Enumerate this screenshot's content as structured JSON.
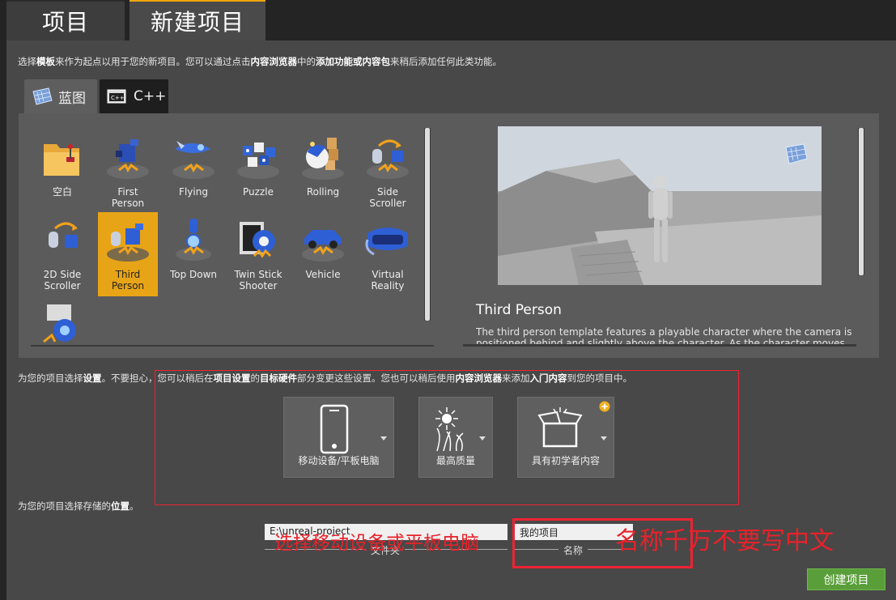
{
  "tabs": {
    "projects": "项目",
    "new_project": "新建项目"
  },
  "template_hint": {
    "p1": "选择",
    "b1": "模板",
    "p2": "来作为起点以用于您的新项目。您可以通过点击",
    "b2": "内容浏览器",
    "p3": "中的",
    "b3": "添加功能或内容包",
    "p4": "来稍后添加任何此类功能。"
  },
  "lang_tabs": {
    "blueprint": "蓝图",
    "cpp": "C++"
  },
  "templates": [
    {
      "label": "空白",
      "icon": "folder-joystick-icon"
    },
    {
      "label": "First\nPerson",
      "icon": "first-person-icon"
    },
    {
      "label": "Flying",
      "icon": "flying-icon"
    },
    {
      "label": "Puzzle",
      "icon": "puzzle-icon"
    },
    {
      "label": "Rolling",
      "icon": "rolling-icon"
    },
    {
      "label": "Side\nScroller",
      "icon": "side-scroller-icon"
    },
    {
      "label": "2D Side\nScroller",
      "icon": "2d-side-scroller-icon"
    },
    {
      "label": "Third\nPerson",
      "icon": "third-person-icon",
      "selected": true
    },
    {
      "label": "Top Down",
      "icon": "top-down-icon"
    },
    {
      "label": "Twin Stick\nShooter",
      "icon": "twin-stick-shooter-icon"
    },
    {
      "label": "Vehicle",
      "icon": "vehicle-icon"
    },
    {
      "label": "Virtual\nReality",
      "icon": "virtual-reality-icon"
    },
    {
      "label": "",
      "icon": "vehicle-advanced-icon"
    }
  ],
  "preview": {
    "title": "Third Person",
    "description": "The third person template features a playable character where the camera is positioned behind and slightly above the character. As the character moves using"
  },
  "settings_hint": {
    "p1": "为您的项目选择",
    "b1": "设置",
    "p2": "。不要担心，您可以稍后在",
    "b2": "项目设置",
    "p3": "的",
    "b3": "目标硬件",
    "p4": "部分变更这些设置。您也可以稍后使用",
    "b4": "内容浏览器",
    "p5": "来添加",
    "b5": "入门内容",
    "p6": "到您的项目中。"
  },
  "settings": [
    {
      "label": "移动设备/平板电脑",
      "icon": "mobile-tablet-icon"
    },
    {
      "label": "最高质量",
      "icon": "max-quality-icon"
    },
    {
      "label": "具有初学者内容",
      "icon": "starter-content-icon"
    }
  ],
  "location_hint": {
    "p1": "为您的项目选择存储的",
    "b1": "位置",
    "p2": "。"
  },
  "folder": {
    "value": "E:\\unreal-project",
    "caption": "文件夹"
  },
  "name": {
    "value": "我的项目",
    "caption": "名称"
  },
  "annotations": {
    "device": "选择移动设备或平板电脑",
    "name": "名称千万不要写中文"
  },
  "create_button": "创建项目",
  "colors": {
    "selected": "#e8a417",
    "accent_tab": "#f0a60b",
    "create": "#5a9e3a",
    "annotation": "#e8222b"
  }
}
